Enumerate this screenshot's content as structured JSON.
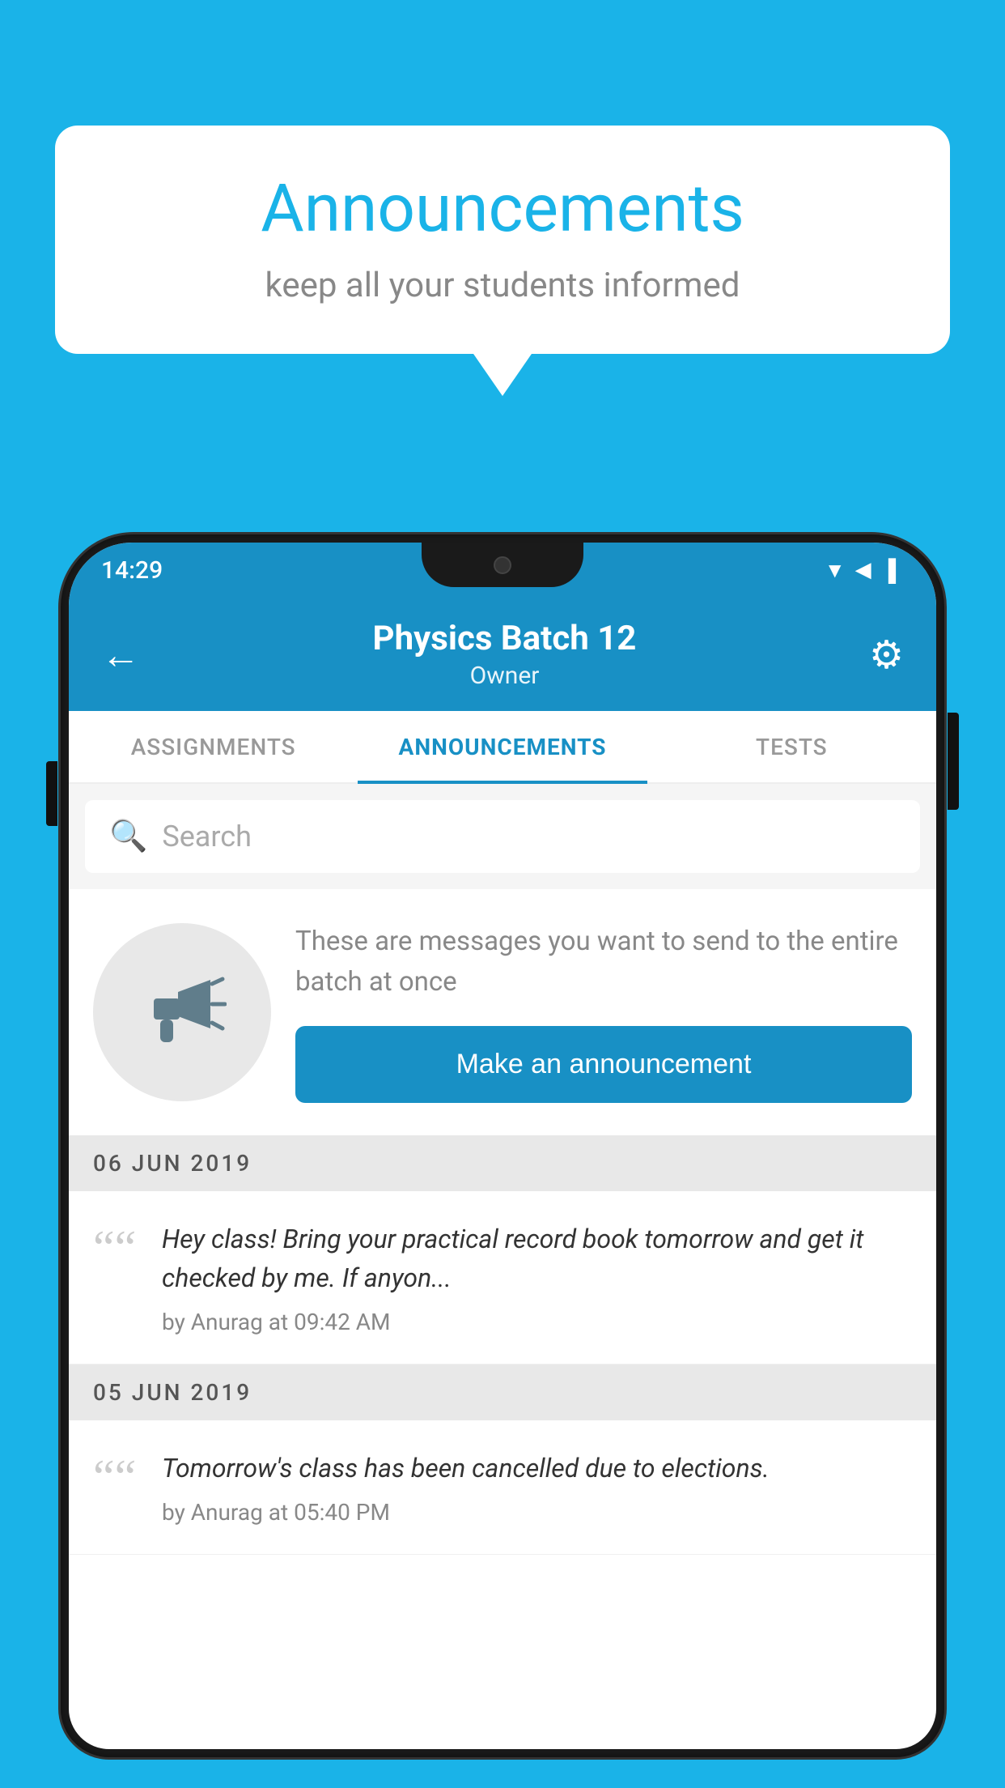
{
  "background_color": "#1ab3e8",
  "speech_bubble": {
    "title": "Announcements",
    "subtitle": "keep all your students informed"
  },
  "phone": {
    "status_bar": {
      "time": "14:29",
      "wifi": "▼",
      "signal": "▲",
      "battery": "▐"
    },
    "header": {
      "back_label": "←",
      "title": "Physics Batch 12",
      "subtitle": "Owner",
      "gear_label": "⚙"
    },
    "tabs": [
      {
        "id": "assignments",
        "label": "ASSIGNMENTS",
        "active": false
      },
      {
        "id": "announcements",
        "label": "ANNOUNCEMENTS",
        "active": true
      },
      {
        "id": "tests",
        "label": "TESTS",
        "active": false
      }
    ],
    "search": {
      "placeholder": "Search"
    },
    "promo": {
      "description": "These are messages you want to send to the entire batch at once",
      "button_label": "Make an announcement"
    },
    "date_groups": [
      {
        "date": "06  JUN  2019",
        "announcements": [
          {
            "text": "Hey class! Bring your practical record book tomorrow and get it checked by me. If anyon...",
            "author": "by Anurag at 09:42 AM"
          }
        ]
      },
      {
        "date": "05  JUN  2019",
        "announcements": [
          {
            "text": "Tomorrow's class has been cancelled due to elections.",
            "author": "by Anurag at 05:40 PM"
          }
        ]
      }
    ]
  }
}
